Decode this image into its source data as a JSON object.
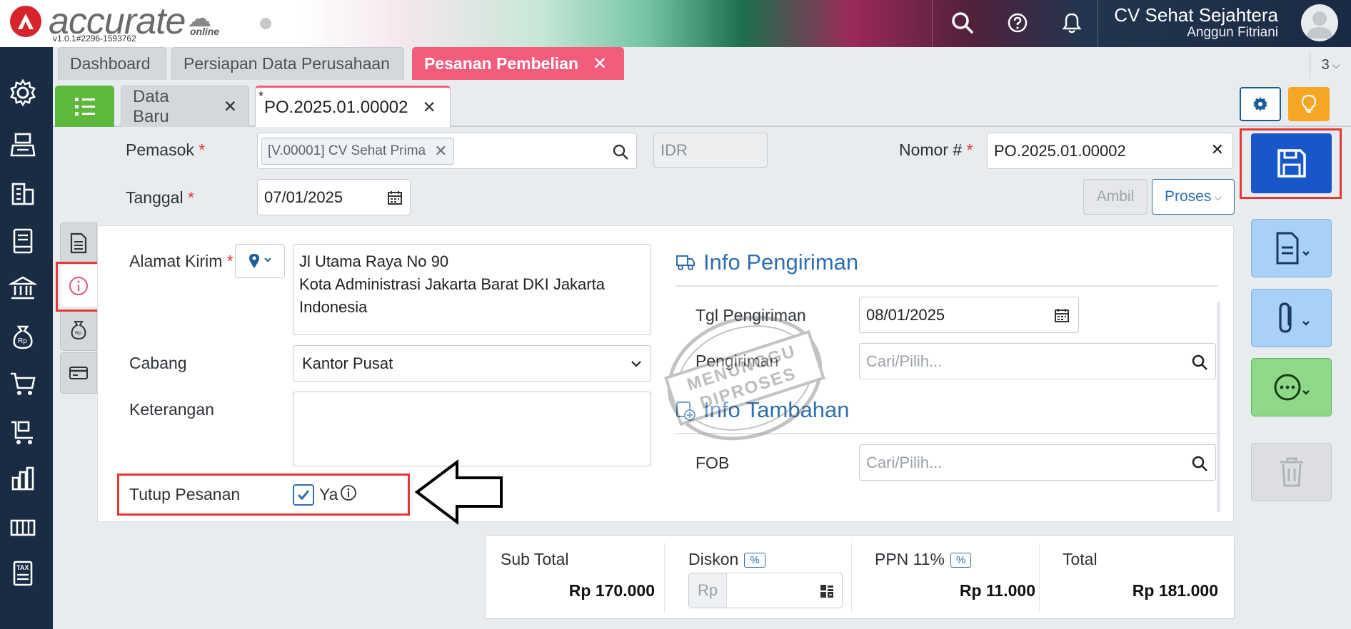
{
  "header": {
    "logo_text": "accurate",
    "logo_sub": "online",
    "version": "v1.0.1#2296-1593762",
    "company": "CV Sehat Sejahtera",
    "user": "Anggun Fitriani"
  },
  "module_tabs": [
    {
      "label": "Dashboard"
    },
    {
      "label": "Persiapan Data Perusahaan"
    },
    {
      "label": "Pesanan Pembelian"
    }
  ],
  "tab_count": "3",
  "sub_tabs": [
    {
      "label": "Data Baru"
    },
    {
      "label": "PO.2025.01.00002",
      "modified_mark": "*"
    }
  ],
  "form": {
    "pemasok_label": "Pemasok",
    "pemasok_value": "[V.00001] CV Sehat Prima",
    "currency": "IDR",
    "nomor_label": "Nomor #",
    "nomor_value": "PO.2025.01.00002",
    "tanggal_label": "Tanggal",
    "tanggal_value": "07/01/2025",
    "ambil_label": "Ambil",
    "proses_label": "Proses",
    "required_mark": "*"
  },
  "panel": {
    "alamat_label": "Alamat Kirim",
    "alamat_lines": [
      "Jl Utama Raya No 90",
      "Kota Administrasi Jakarta Barat DKI Jakarta",
      "Indonesia"
    ],
    "cabang_label": "Cabang",
    "cabang_value": "Kantor Pusat",
    "keterangan_label": "Keterangan",
    "tutup_label": "Tutup Pesanan",
    "tutup_value": "Ya",
    "tutup_checked": true,
    "info_pengiriman_title": "Info Pengiriman",
    "tgl_pengiriman_label": "Tgl Pengiriman",
    "tgl_pengiriman_value": "08/01/2025",
    "pengiriman_label": "Pengiriman",
    "pengiriman_placeholder": "Cari/Pilih...",
    "info_tambahan_title": "Info Tambahan",
    "fob_label": "FOB",
    "fob_placeholder": "Cari/Pilih...",
    "stamp_line1": "MENUNGGU",
    "stamp_line2": "DIPROSES"
  },
  "totals": {
    "subtotal_label": "Sub Total",
    "subtotal_value": "Rp 170.000",
    "diskon_label": "Diskon",
    "diskon_pct": "%",
    "diskon_placeholder": "Rp",
    "ppn_label": "PPN 11%",
    "ppn_pct": "%",
    "ppn_value": "Rp 11.000",
    "total_label": "Total",
    "total_value": "Rp 181.000"
  },
  "colors": {
    "accent_pink": "#f25d7b",
    "primary_blue": "#1857c9",
    "sidebar": "#192c44",
    "highlight_red": "#e53935"
  }
}
